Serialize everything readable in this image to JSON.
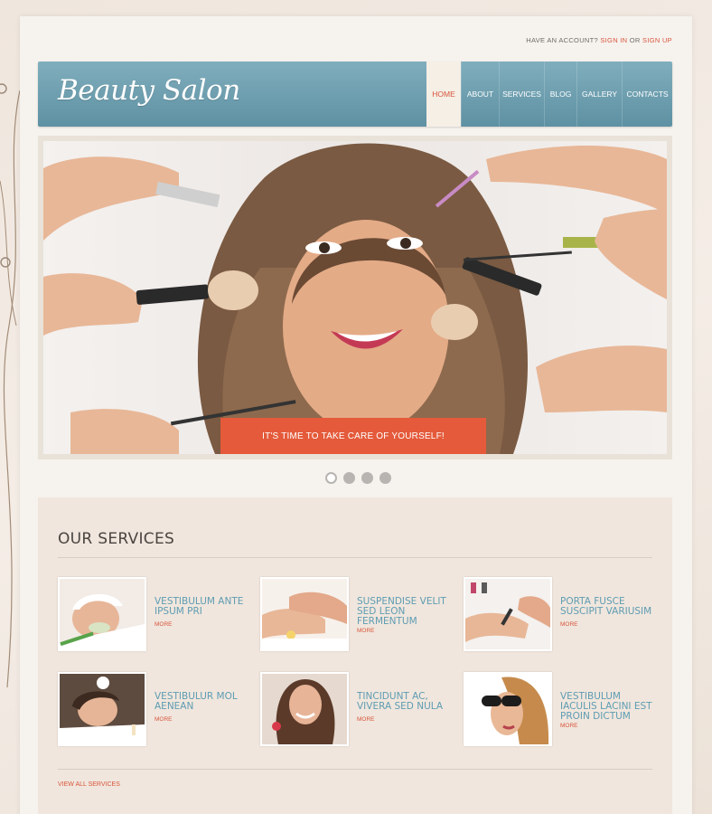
{
  "topbar": {
    "prefix": "HAVE AN ACCOUNT?",
    "sign_in": "SIGN IN",
    "or": "OR",
    "sign_up": "SIGN UP"
  },
  "header": {
    "logo": "Beauty Salon"
  },
  "nav": [
    {
      "label": "HOME",
      "active": true
    },
    {
      "label": "ABOUT"
    },
    {
      "label": "SERVICES"
    },
    {
      "label": "BLOG"
    },
    {
      "label": "GALLERY"
    },
    {
      "label": "CONTACTS"
    }
  ],
  "slider": {
    "caption": "IT'S TIME TO TAKE CARE OF YOURSELF!",
    "dots": 4,
    "active_dot": 1
  },
  "services": {
    "heading": "OUR SERVICES",
    "items": [
      {
        "title": "VESTIBULUM ANTE IPSUM PRI",
        "more": "MORE"
      },
      {
        "title": "SUSPENDISE VELIT SED LEON FERMENTUM",
        "more": "MORE"
      },
      {
        "title": "PORTA FUSCE SUSCIPIT VARIUSIM",
        "more": "MORE"
      },
      {
        "title": "VESTIBULUR MOL AENEAN",
        "more": "MORE"
      },
      {
        "title": "TINCIDUNT AC, VIVERA SED NULA",
        "more": "MORE"
      },
      {
        "title": "VESTIBULUM IACULIS LACINI EST PROIN DICTUM",
        "more": "MORE"
      }
    ],
    "view_all": "VIEW ALL SERVICES"
  },
  "colors": {
    "accent": "#d8553c",
    "header": "#6b9cae",
    "service_title": "#5e9cb2"
  }
}
